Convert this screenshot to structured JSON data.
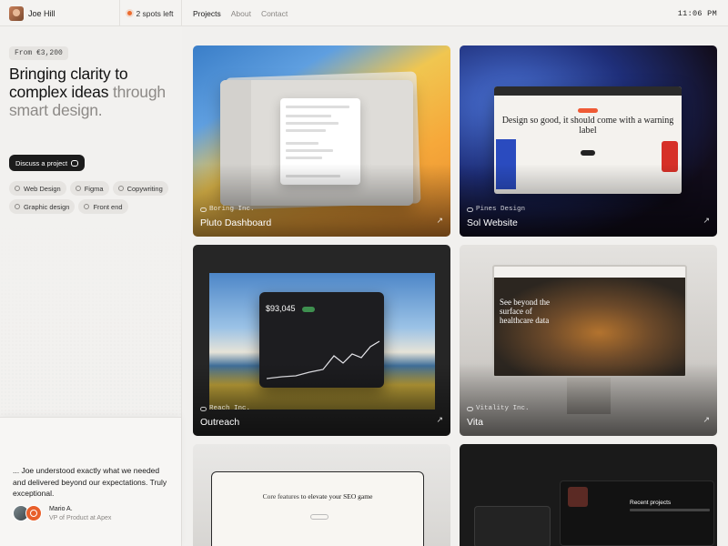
{
  "header": {
    "name": "Joe Hill",
    "spots": "2 spots left",
    "nav": [
      "Projects",
      "About",
      "Contact"
    ],
    "clock": "11:06 PM"
  },
  "sidebar": {
    "price": "From €3,200",
    "headline_main": "Bringing clarity to complex ideas",
    "headline_muted": "through smart design.",
    "cta": "Discuss a project",
    "tags": [
      "Web Design",
      "Figma",
      "Copywriting",
      "Graphic design",
      "Front end"
    ]
  },
  "testimonial": {
    "quote": "... Joe understood exactly what we needed and delivered beyond our expectations. Truly exceptional.",
    "name": "Mario A.",
    "role": "VP of Product at Apex"
  },
  "projects": [
    {
      "client": "Boring Inc.",
      "title": "Pluto Dashboard"
    },
    {
      "client": "Pines Design",
      "title": "Sol Website"
    },
    {
      "client": "Reach Inc.",
      "title": "Outreach"
    },
    {
      "client": "Vitality Inc.",
      "title": "Vita"
    }
  ],
  "mockups": {
    "sol_headline": "Design so good, it should come with a warning label",
    "outreach_value": "$93,045",
    "vita_headline": "See beyond the surface of healthcare data",
    "seo_prefix": "Core features",
    "seo_rest": "to elevate your SEO game",
    "recent_projects": "Recent projects"
  },
  "colors": {
    "accent": "#ec6b2d",
    "dark": "#1c1c1c",
    "background": "#f1f0ee"
  }
}
